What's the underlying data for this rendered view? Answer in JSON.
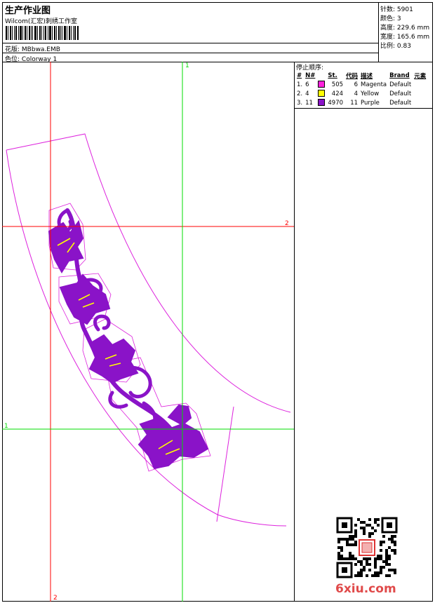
{
  "header": {
    "title": "生产作业图",
    "company": "Wilcom(汇宏)刺绣工作室",
    "design_label": "花版:",
    "design_value": "MBbwa.EMB",
    "colorway_label": "色位:",
    "colorway_value": "Colorway 1"
  },
  "stats": [
    {
      "label": "针数:",
      "value": "5901"
    },
    {
      "label": "颜色:",
      "value": "3"
    },
    {
      "label": "高度:",
      "value": "229.6 mm"
    },
    {
      "label": "宽度:",
      "value": "165.6 mm"
    },
    {
      "label": "比例:",
      "value": "0.83"
    }
  ],
  "stop_sequence": {
    "title": "停止顺序:",
    "headers": [
      "#",
      "N#",
      "St.",
      "代码",
      "描述",
      "Brand",
      "元素"
    ],
    "rows": [
      {
        "idx": "1.",
        "n": "6",
        "color": "#ff22dd",
        "stitches": "505",
        "code": "6",
        "desc": "Magenta",
        "brand": "Default"
      },
      {
        "idx": "2.",
        "n": "4",
        "color": "#ffff00",
        "stitches": "424",
        "code": "4",
        "desc": "Yellow",
        "brand": "Default"
      },
      {
        "idx": "3.",
        "n": "11",
        "color": "#8a13c8",
        "stitches": "4970",
        "code": "11",
        "desc": "Purple",
        "brand": "Default"
      }
    ]
  },
  "guides": {
    "v1_label": "1",
    "h2_label": "2",
    "h1_label": "1",
    "v2_label": "2",
    "red": "#ff0000",
    "green": "#00dd00"
  },
  "colors": {
    "outline": "#dd22dd",
    "embroidery": "#8a13c8",
    "highlight": "#ffff00"
  },
  "watermark": "6xiu.com"
}
